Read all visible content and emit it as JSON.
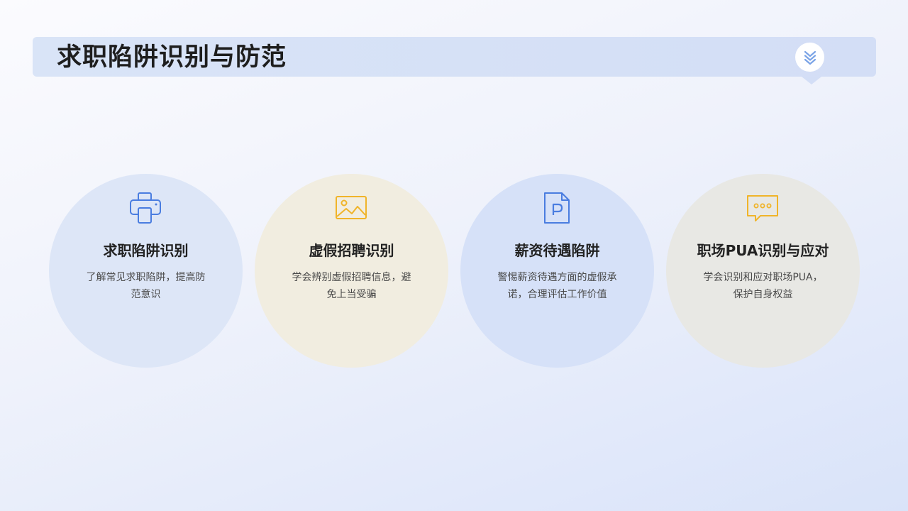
{
  "header": {
    "title": "求职陷阱识别与防范"
  },
  "colors": {
    "blue_icon": "#4a7de0",
    "yellow_icon": "#f0b429"
  },
  "cards": [
    {
      "icon": "printer-icon",
      "title": "求职陷阱识别",
      "description": "了解常见求职陷阱，提高防范意识"
    },
    {
      "icon": "image-icon",
      "title": "虚假招聘识别",
      "description": "学会辨别虚假招聘信息，避免上当受骗"
    },
    {
      "icon": "document-p-icon",
      "title": "薪资待遇陷阱",
      "description": "警惕薪资待遇方面的虚假承诺，合理评估工作价值"
    },
    {
      "icon": "chat-bubble-icon",
      "title": "职场PUA识别与应对",
      "description": "学会识别和应对职场PUA，保护自身权益"
    }
  ]
}
